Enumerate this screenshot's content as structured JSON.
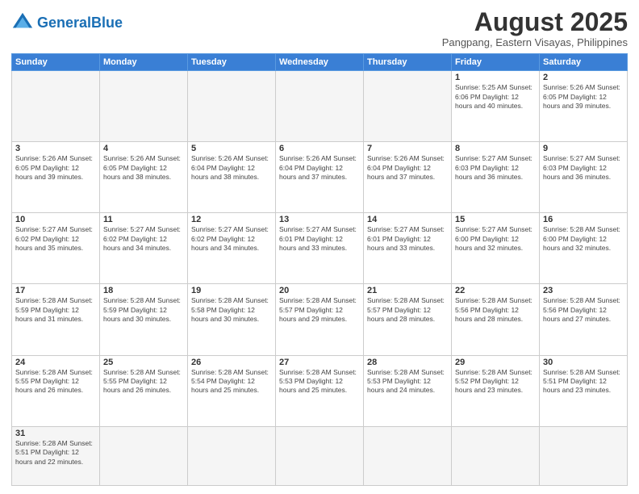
{
  "header": {
    "logo_general": "General",
    "logo_blue": "Blue",
    "month_title": "August 2025",
    "subtitle": "Pangpang, Eastern Visayas, Philippines"
  },
  "days_of_week": [
    "Sunday",
    "Monday",
    "Tuesday",
    "Wednesday",
    "Thursday",
    "Friday",
    "Saturday"
  ],
  "weeks": [
    [
      {
        "day": "",
        "info": ""
      },
      {
        "day": "",
        "info": ""
      },
      {
        "day": "",
        "info": ""
      },
      {
        "day": "",
        "info": ""
      },
      {
        "day": "",
        "info": ""
      },
      {
        "day": "1",
        "info": "Sunrise: 5:25 AM\nSunset: 6:06 PM\nDaylight: 12 hours\nand 40 minutes."
      },
      {
        "day": "2",
        "info": "Sunrise: 5:26 AM\nSunset: 6:05 PM\nDaylight: 12 hours\nand 39 minutes."
      }
    ],
    [
      {
        "day": "3",
        "info": "Sunrise: 5:26 AM\nSunset: 6:05 PM\nDaylight: 12 hours\nand 39 minutes."
      },
      {
        "day": "4",
        "info": "Sunrise: 5:26 AM\nSunset: 6:05 PM\nDaylight: 12 hours\nand 38 minutes."
      },
      {
        "day": "5",
        "info": "Sunrise: 5:26 AM\nSunset: 6:04 PM\nDaylight: 12 hours\nand 38 minutes."
      },
      {
        "day": "6",
        "info": "Sunrise: 5:26 AM\nSunset: 6:04 PM\nDaylight: 12 hours\nand 37 minutes."
      },
      {
        "day": "7",
        "info": "Sunrise: 5:26 AM\nSunset: 6:04 PM\nDaylight: 12 hours\nand 37 minutes."
      },
      {
        "day": "8",
        "info": "Sunrise: 5:27 AM\nSunset: 6:03 PM\nDaylight: 12 hours\nand 36 minutes."
      },
      {
        "day": "9",
        "info": "Sunrise: 5:27 AM\nSunset: 6:03 PM\nDaylight: 12 hours\nand 36 minutes."
      }
    ],
    [
      {
        "day": "10",
        "info": "Sunrise: 5:27 AM\nSunset: 6:02 PM\nDaylight: 12 hours\nand 35 minutes."
      },
      {
        "day": "11",
        "info": "Sunrise: 5:27 AM\nSunset: 6:02 PM\nDaylight: 12 hours\nand 34 minutes."
      },
      {
        "day": "12",
        "info": "Sunrise: 5:27 AM\nSunset: 6:02 PM\nDaylight: 12 hours\nand 34 minutes."
      },
      {
        "day": "13",
        "info": "Sunrise: 5:27 AM\nSunset: 6:01 PM\nDaylight: 12 hours\nand 33 minutes."
      },
      {
        "day": "14",
        "info": "Sunrise: 5:27 AM\nSunset: 6:01 PM\nDaylight: 12 hours\nand 33 minutes."
      },
      {
        "day": "15",
        "info": "Sunrise: 5:27 AM\nSunset: 6:00 PM\nDaylight: 12 hours\nand 32 minutes."
      },
      {
        "day": "16",
        "info": "Sunrise: 5:28 AM\nSunset: 6:00 PM\nDaylight: 12 hours\nand 32 minutes."
      }
    ],
    [
      {
        "day": "17",
        "info": "Sunrise: 5:28 AM\nSunset: 5:59 PM\nDaylight: 12 hours\nand 31 minutes."
      },
      {
        "day": "18",
        "info": "Sunrise: 5:28 AM\nSunset: 5:59 PM\nDaylight: 12 hours\nand 30 minutes."
      },
      {
        "day": "19",
        "info": "Sunrise: 5:28 AM\nSunset: 5:58 PM\nDaylight: 12 hours\nand 30 minutes."
      },
      {
        "day": "20",
        "info": "Sunrise: 5:28 AM\nSunset: 5:57 PM\nDaylight: 12 hours\nand 29 minutes."
      },
      {
        "day": "21",
        "info": "Sunrise: 5:28 AM\nSunset: 5:57 PM\nDaylight: 12 hours\nand 28 minutes."
      },
      {
        "day": "22",
        "info": "Sunrise: 5:28 AM\nSunset: 5:56 PM\nDaylight: 12 hours\nand 28 minutes."
      },
      {
        "day": "23",
        "info": "Sunrise: 5:28 AM\nSunset: 5:56 PM\nDaylight: 12 hours\nand 27 minutes."
      }
    ],
    [
      {
        "day": "24",
        "info": "Sunrise: 5:28 AM\nSunset: 5:55 PM\nDaylight: 12 hours\nand 26 minutes."
      },
      {
        "day": "25",
        "info": "Sunrise: 5:28 AM\nSunset: 5:55 PM\nDaylight: 12 hours\nand 26 minutes."
      },
      {
        "day": "26",
        "info": "Sunrise: 5:28 AM\nSunset: 5:54 PM\nDaylight: 12 hours\nand 25 minutes."
      },
      {
        "day": "27",
        "info": "Sunrise: 5:28 AM\nSunset: 5:53 PM\nDaylight: 12 hours\nand 25 minutes."
      },
      {
        "day": "28",
        "info": "Sunrise: 5:28 AM\nSunset: 5:53 PM\nDaylight: 12 hours\nand 24 minutes."
      },
      {
        "day": "29",
        "info": "Sunrise: 5:28 AM\nSunset: 5:52 PM\nDaylight: 12 hours\nand 23 minutes."
      },
      {
        "day": "30",
        "info": "Sunrise: 5:28 AM\nSunset: 5:51 PM\nDaylight: 12 hours\nand 23 minutes."
      }
    ],
    [
      {
        "day": "31",
        "info": "Sunrise: 5:28 AM\nSunset: 5:51 PM\nDaylight: 12 hours\nand 22 minutes."
      },
      {
        "day": "",
        "info": ""
      },
      {
        "day": "",
        "info": ""
      },
      {
        "day": "",
        "info": ""
      },
      {
        "day": "",
        "info": ""
      },
      {
        "day": "",
        "info": ""
      },
      {
        "day": "",
        "info": ""
      }
    ]
  ]
}
